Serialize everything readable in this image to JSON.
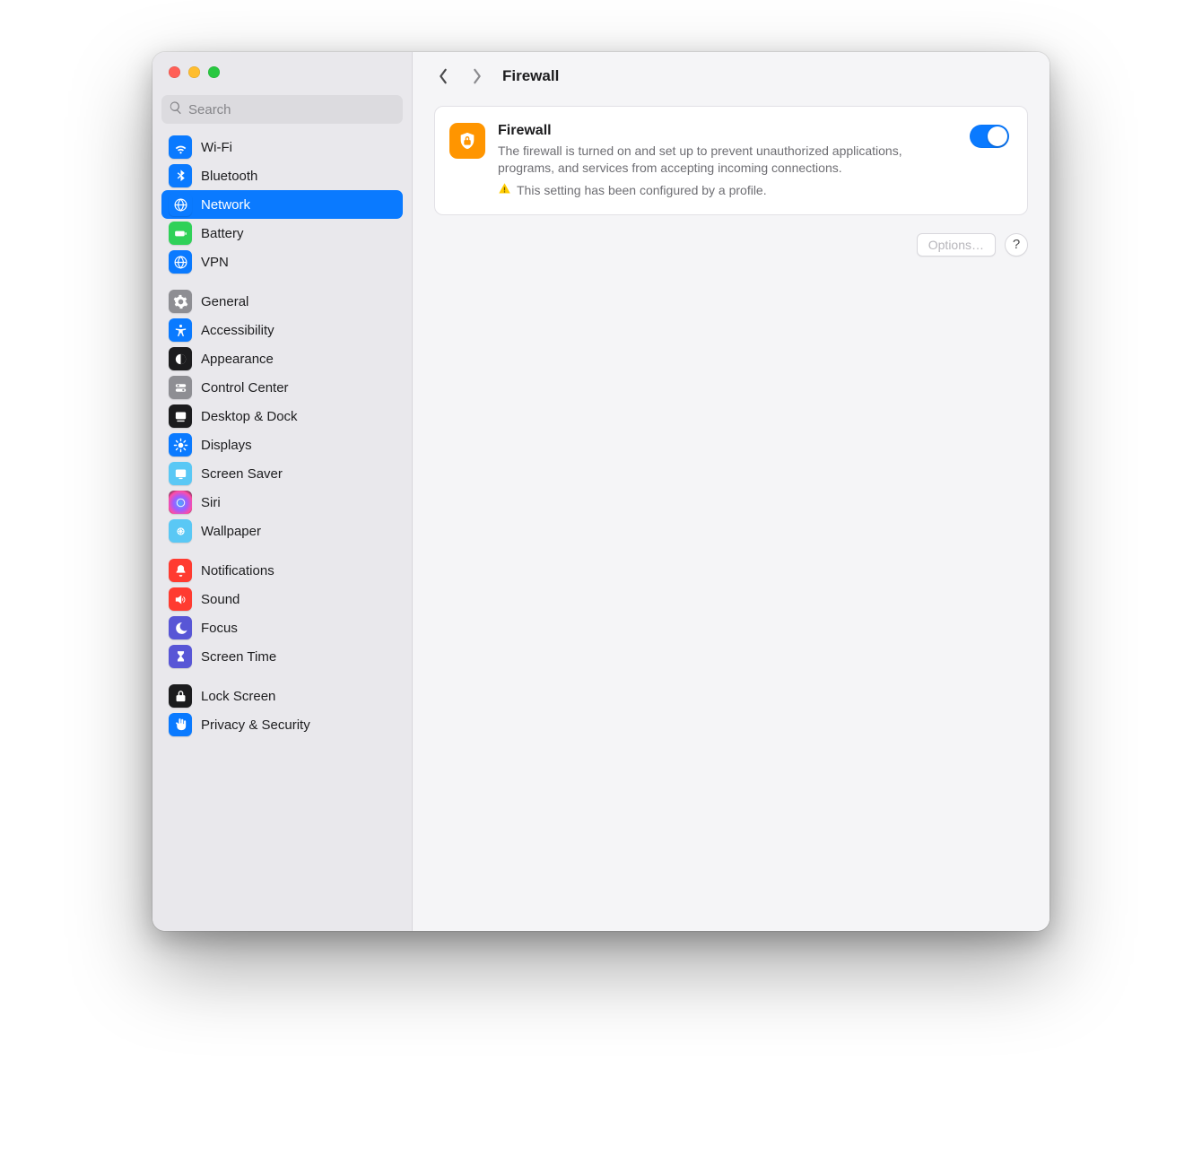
{
  "window": {
    "title": "Firewall"
  },
  "search": {
    "placeholder": "Search"
  },
  "sidebar": {
    "groups": [
      [
        {
          "label": "Wi-Fi"
        },
        {
          "label": "Bluetooth"
        },
        {
          "label": "Network",
          "selected": true
        },
        {
          "label": "Battery"
        },
        {
          "label": "VPN"
        }
      ],
      [
        {
          "label": "General"
        },
        {
          "label": "Accessibility"
        },
        {
          "label": "Appearance"
        },
        {
          "label": "Control Center"
        },
        {
          "label": "Desktop & Dock"
        },
        {
          "label": "Displays"
        },
        {
          "label": "Screen Saver"
        },
        {
          "label": "Siri"
        },
        {
          "label": "Wallpaper"
        }
      ],
      [
        {
          "label": "Notifications"
        },
        {
          "label": "Sound"
        },
        {
          "label": "Focus"
        },
        {
          "label": "Screen Time"
        }
      ],
      [
        {
          "label": "Lock Screen"
        },
        {
          "label": "Privacy & Security"
        }
      ]
    ]
  },
  "firewall": {
    "title": "Firewall",
    "description": "The firewall is turned on and set up to prevent unauthorized applications, programs, and services from accepting incoming connections.",
    "note": "This setting has been configured by a profile.",
    "enabled": true
  },
  "actions": {
    "options_label": "Options…",
    "options_enabled": false,
    "help_label": "?"
  }
}
